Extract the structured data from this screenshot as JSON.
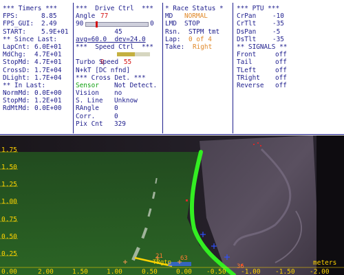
{
  "timers": {
    "title": "*** Timers ***",
    "rows": [
      {
        "label": "FPS:",
        "value": "8.85"
      },
      {
        "label": "FPS_GUI:",
        "value": "2.49"
      },
      {
        "label": "START:",
        "value": "5.9E+01"
      }
    ],
    "since_title": "** Since Last:",
    "since_rows": [
      {
        "label": "LapCnt:",
        "value": "6.0E+01"
      },
      {
        "label": "MdChg:",
        "value": "4.7E+01"
      },
      {
        "label": "StopMd:",
        "value": "4.7E+01"
      },
      {
        "label": "CrossD:",
        "value": "1.7E+04"
      },
      {
        "label": "DLight:",
        "value": "1.7E+04"
      }
    ],
    "in_title": "** In Last:",
    "in_rows": [
      {
        "label": "NormMd:",
        "value": "0.0E+00"
      },
      {
        "label": "StopMd:",
        "value": "1.2E+01"
      },
      {
        "label": "RdMtMd:",
        "value": "0.0E+00"
      }
    ]
  },
  "drive": {
    "title": "***  Drive Ctrl  ***",
    "angle_label": "Angle",
    "angle_value": "77",
    "slider_min": "90",
    "slider_max": "0",
    "slider_level": 0.16,
    "slider_center": "45",
    "avg_text": "avg=60.0  dev=24.0",
    "speed_title": "***  Speed Ctrl  ***",
    "speed_label": "Speed",
    "speed_value": "55",
    "speed_level": 0.55,
    "turbo_label": "Turbo",
    "turbo_value": "0",
    "nkt_text": "N+kT [DC nfnd]",
    "cross_title": "*** Cross Det. ***",
    "cross_rows": [
      {
        "label": "Sensor",
        "value": "Not Detect."
      },
      {
        "label": "Vision",
        "value": "no"
      },
      {
        "label": "S. Line",
        "value": "Unknow"
      },
      {
        "label": "RAngle",
        "value": "0"
      },
      {
        "label": "Corr.",
        "value": "0"
      },
      {
        "label": "Pix Cnt",
        "value": "329"
      }
    ]
  },
  "race": {
    "title": "* Race Status *",
    "rows": [
      {
        "label": "MD",
        "value": "NORMAL",
        "color": "#e08828"
      },
      {
        "label": "LMD",
        "value": "STOP",
        "color": "#1c1c8c"
      },
      {
        "label": "Rsn.",
        "value": "STPM tmt",
        "color": "#1c1c8c"
      },
      {
        "label": "Lap:",
        "value": "0 of 4",
        "color": "#e08828"
      },
      {
        "label": "Take:",
        "value": "Right",
        "color": "#e08828"
      }
    ]
  },
  "ptu": {
    "title": "*** PTU ***",
    "rows": [
      {
        "label": "CrPan",
        "value": "-10"
      },
      {
        "label": "CrTlt",
        "value": "-35"
      },
      {
        "label": "DsPan",
        "value": "-5"
      },
      {
        "label": "DsTlt",
        "value": "-35"
      }
    ],
    "signals_title": "** SIGNALS **",
    "signals": [
      {
        "label": "Front",
        "value": "off"
      },
      {
        "label": "Tail",
        "value": "off"
      },
      {
        "label": "TLeft",
        "value": "off"
      },
      {
        "label": "TRight",
        "value": "off"
      },
      {
        "label": "Reverse",
        "value": "off"
      }
    ]
  },
  "view": {
    "y_ticks": [
      "1.75",
      "1.50",
      "1.25",
      "1.00",
      "0.75",
      "0.50",
      "0.25",
      "0.00"
    ],
    "x_ticks": [
      "2.00",
      "1.50",
      "1.00",
      "0.50",
      "0.00",
      "-0.50",
      "-1.00",
      "-1.50",
      "-2.00"
    ],
    "x_unit": "meters",
    "markers": [
      "TRgtp",
      "21",
      "63",
      "36"
    ]
  },
  "colors": {
    "hud_text": "#1c1c8c",
    "alert": "#d41010",
    "mode": "#e08828",
    "ok": "#10a010",
    "track_line": "#33ee22",
    "ground_tint": "#1e5a1c",
    "axis": "#ffd400"
  }
}
